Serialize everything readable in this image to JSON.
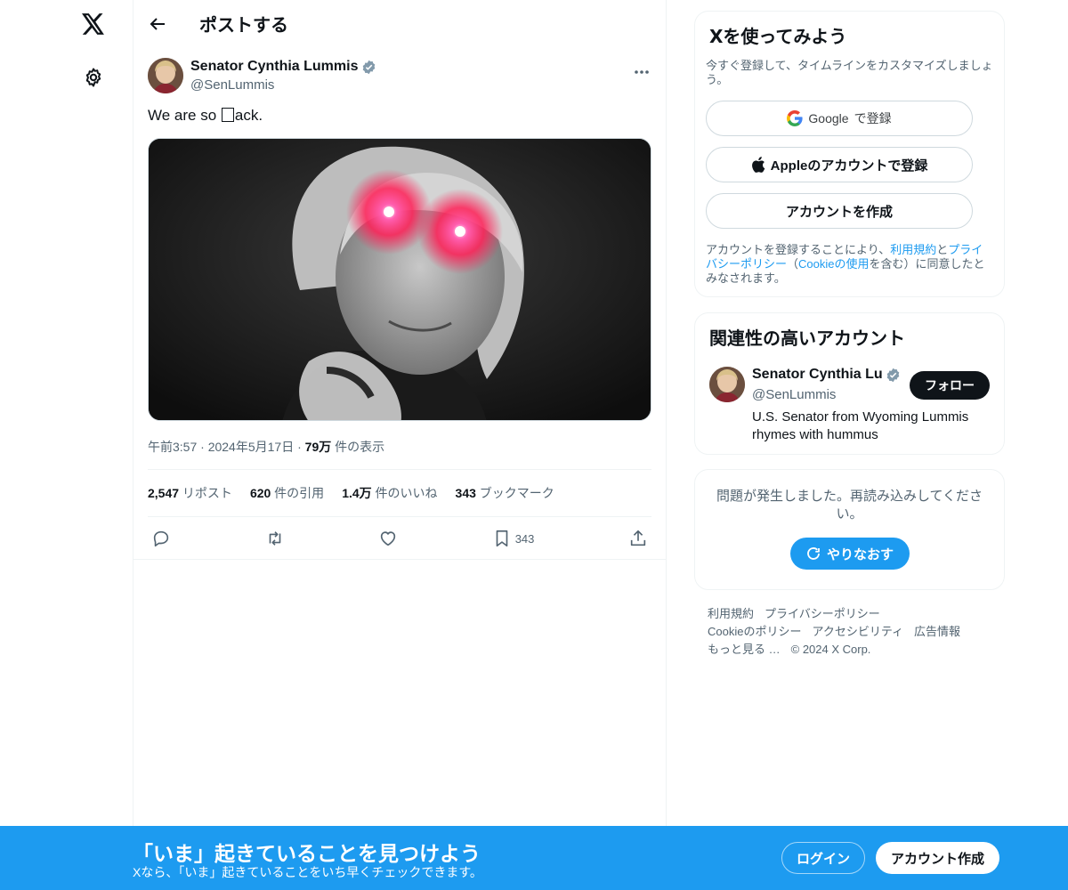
{
  "header": {
    "title": "ポストする"
  },
  "tweet": {
    "author_name": "Senator Cynthia Lummis",
    "author_handle": "@SenLummis",
    "text_before": "We are so ",
    "text_after": "ack.",
    "time": "午前3:57",
    "dot1": "·",
    "date": "2024年5月17日",
    "dot2": "·",
    "views_count": "79万",
    "views_label": " 件の表示",
    "stats": {
      "reposts_count": "2,547",
      "reposts_label": " リポスト",
      "quotes_count": "620",
      "quotes_label": " 件の引用",
      "likes_count": "1.4万",
      "likes_label": " 件のいいね",
      "bookmarks_count": "343",
      "bookmarks_label": " ブックマーク"
    },
    "action_bookmark_count": "343"
  },
  "signup": {
    "title": "Xを使ってみよう",
    "subtitle": "今すぐ登録して、タイムラインをカスタマイズしましょう。",
    "google_brand": "Google",
    "google_label": " で登録",
    "apple_label": "Appleのアカウントで登録",
    "create_label": "アカウントを作成",
    "legal_1": "アカウントを登録することにより、",
    "legal_terms": "利用規約",
    "legal_2": "と",
    "legal_privacy": "プライバシーポリシー",
    "legal_3": "（",
    "legal_cookie": "Cookieの使用",
    "legal_4": "を含む）に同意したとみなされます。"
  },
  "related": {
    "title": "関連性の高いアカウント",
    "name": "Senator Cynthia Lummis",
    "handle": "@SenLummis",
    "follow_label": "フォロー",
    "bio": "U.S. Senator from Wyoming Lummis rhymes with hummus"
  },
  "error": {
    "text": "問題が発生しました。再読み込みしてください。",
    "retry_label": "やりなおす"
  },
  "footer": {
    "links": [
      "利用規約",
      "プライバシーポリシー",
      "Cookieのポリシー",
      "アクセシビリティ",
      "広告情報",
      "もっと見る …"
    ],
    "copyright": "© 2024 X Corp."
  },
  "bottombar": {
    "title": "「いま」起きていることを見つけよう",
    "subtitle": "Xなら、「いま」起きていることをいち早くチェックできます。",
    "login_label": "ログイン",
    "signup_label": "アカウント作成"
  },
  "colors": {
    "accent": "#1d9bf0",
    "text": "#0f1419",
    "secondary": "#536471",
    "eye_glow": "#ff2d6f"
  }
}
